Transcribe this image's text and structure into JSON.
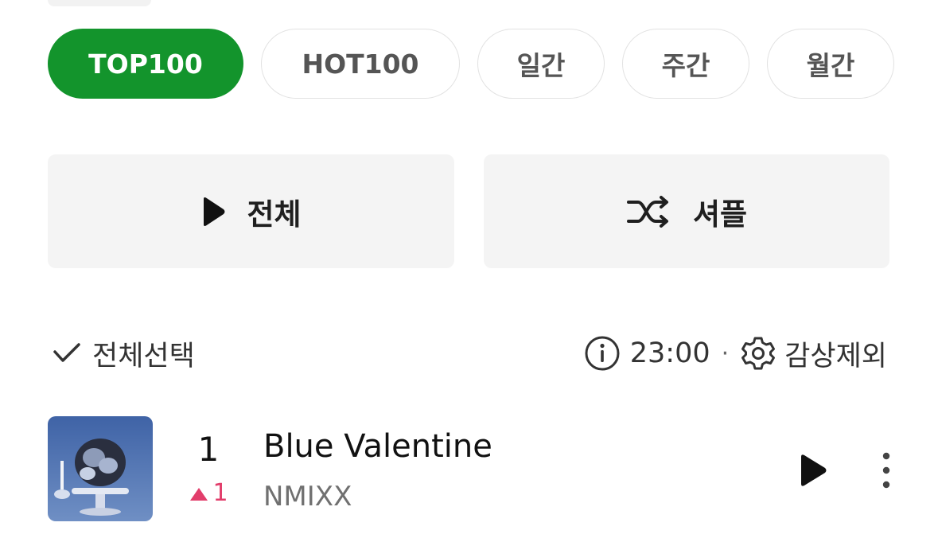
{
  "tabs": [
    {
      "label": "TOP100",
      "active": true
    },
    {
      "label": "HOT100",
      "active": false
    },
    {
      "label": "일간",
      "active": false
    },
    {
      "label": "주간",
      "active": false
    },
    {
      "label": "월간",
      "active": false
    }
  ],
  "actions": {
    "play_all_label": "전체",
    "shuffle_label": "셔플"
  },
  "list_controls": {
    "select_all_label": "전체선택",
    "time": "23:00",
    "separator": "·",
    "exclude_label": "감상제외"
  },
  "tracks": [
    {
      "rank": "1",
      "change_label": "1",
      "change_direction": "up",
      "title": "Blue Valentine",
      "artist": "NMIXX"
    }
  ],
  "colors": {
    "accent": "#13942c",
    "rank_up": "#e23d6b"
  },
  "icons": {
    "play_all": "play-icon",
    "shuffle": "shuffle-icon",
    "select_all": "check-icon",
    "info": "info-icon",
    "settings": "gear-icon",
    "track_play": "play-icon",
    "track_more": "more-vertical-icon"
  }
}
